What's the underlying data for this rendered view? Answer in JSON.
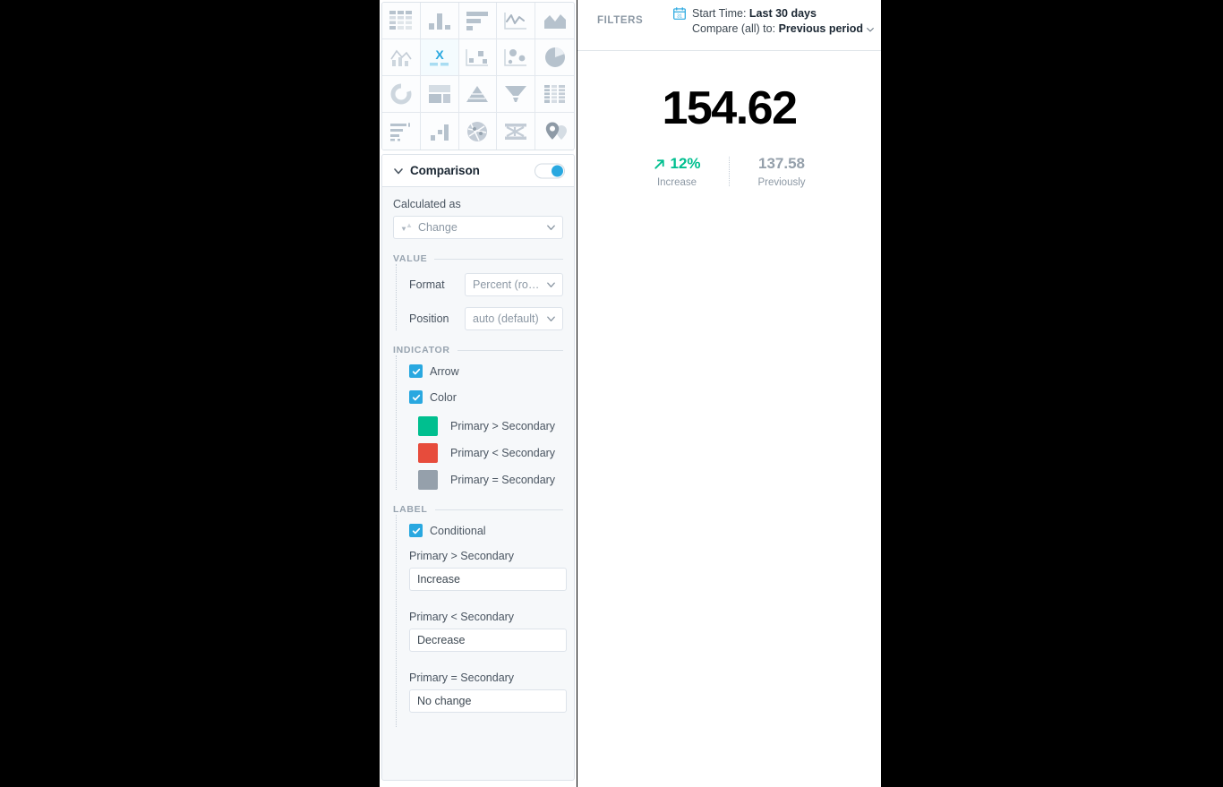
{
  "viz_picker": {
    "selected_index": 6,
    "items": [
      {
        "name": "table",
        "label": "Table"
      },
      {
        "name": "column-chart",
        "label": "Column"
      },
      {
        "name": "bar-chart",
        "label": "Bar"
      },
      {
        "name": "line-chart",
        "label": "Line"
      },
      {
        "name": "area-chart",
        "label": "Area"
      },
      {
        "name": "combo-chart",
        "label": "Combo"
      },
      {
        "name": "single-value",
        "label": "Single Value"
      },
      {
        "name": "scatter-chart",
        "label": "Scatter"
      },
      {
        "name": "bubble-chart",
        "label": "Bubble"
      },
      {
        "name": "pie-chart",
        "label": "Pie"
      },
      {
        "name": "donut-chart",
        "label": "Donut"
      },
      {
        "name": "treemap-chart",
        "label": "Treemap"
      },
      {
        "name": "pyramid-chart",
        "label": "Pyramid"
      },
      {
        "name": "funnel-chart",
        "label": "Funnel"
      },
      {
        "name": "heatmap-chart",
        "label": "Heatmap"
      },
      {
        "name": "gantt-chart",
        "label": "Gantt"
      },
      {
        "name": "waterfall-chart",
        "label": "Waterfall"
      },
      {
        "name": "network-chart",
        "label": "Network"
      },
      {
        "name": "sankey-chart",
        "label": "Sankey"
      },
      {
        "name": "map-chart",
        "label": "Map"
      }
    ]
  },
  "comparison": {
    "title": "Comparison",
    "enabled": true,
    "calculated_as": {
      "label": "Calculated as",
      "value": "Change"
    },
    "value_section": {
      "heading": "VALUE",
      "format": {
        "label": "Format",
        "value": "Percent (ro…"
      },
      "position": {
        "label": "Position",
        "value": "auto (default)"
      }
    },
    "indicator_section": {
      "heading": "INDICATOR",
      "arrow": {
        "label": "Arrow",
        "checked": true
      },
      "color": {
        "label": "Color",
        "checked": true
      },
      "swatches": [
        {
          "label": "Primary > Secondary",
          "color": "#00bf8f"
        },
        {
          "label": "Primary < Secondary",
          "color": "#e74c3c"
        },
        {
          "label": "Primary = Secondary",
          "color": "#95a0ab"
        }
      ]
    },
    "label_section": {
      "heading": "LABEL",
      "conditional": {
        "label": "Conditional",
        "checked": true
      },
      "fields": [
        {
          "label": "Primary > Secondary",
          "value": "Increase"
        },
        {
          "label": "Primary < Secondary",
          "value": "Decrease"
        },
        {
          "label": "Primary = Secondary",
          "value": "No change"
        }
      ]
    }
  },
  "preview": {
    "filters": {
      "label": "FILTERS",
      "start_time_prefix": "Start Time: ",
      "start_time_value": "Last 30 days",
      "compare_prefix": "Compare (all) to: ",
      "compare_value": "Previous period"
    },
    "kpi": {
      "value": "154.62",
      "change_percent": "12%",
      "change_label": "Increase",
      "previous_value": "137.58",
      "previous_label": "Previously",
      "change_color": "#00bf8f",
      "previous_color": "#95a0ab",
      "direction": "up"
    }
  }
}
